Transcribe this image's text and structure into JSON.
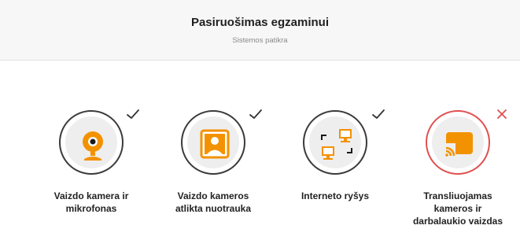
{
  "header": {
    "title": "Pasiruošimas egzaminui",
    "subtitle": "Sistemos patikra"
  },
  "colors": {
    "accent": "#f39200",
    "success": "#333333",
    "error": "#e05050"
  },
  "checks": [
    {
      "label_line1": "Vaizdo kamera ir",
      "label_line2": "mikrofonas",
      "label_line3": "",
      "status": "passed",
      "icon": "webcam-icon"
    },
    {
      "label_line1": "Vaizdo kameros",
      "label_line2": "atlikta nuotrauka",
      "label_line3": "",
      "status": "passed",
      "icon": "photo-portrait-icon"
    },
    {
      "label_line1": "Interneto ryšys",
      "label_line2": "",
      "label_line3": "",
      "status": "passed",
      "icon": "network-computers-icon"
    },
    {
      "label_line1": "Transliuojamas",
      "label_line2": "kameros ir",
      "label_line3": "darbalaukio vaizdas",
      "status": "failed",
      "icon": "screen-cast-icon"
    }
  ]
}
